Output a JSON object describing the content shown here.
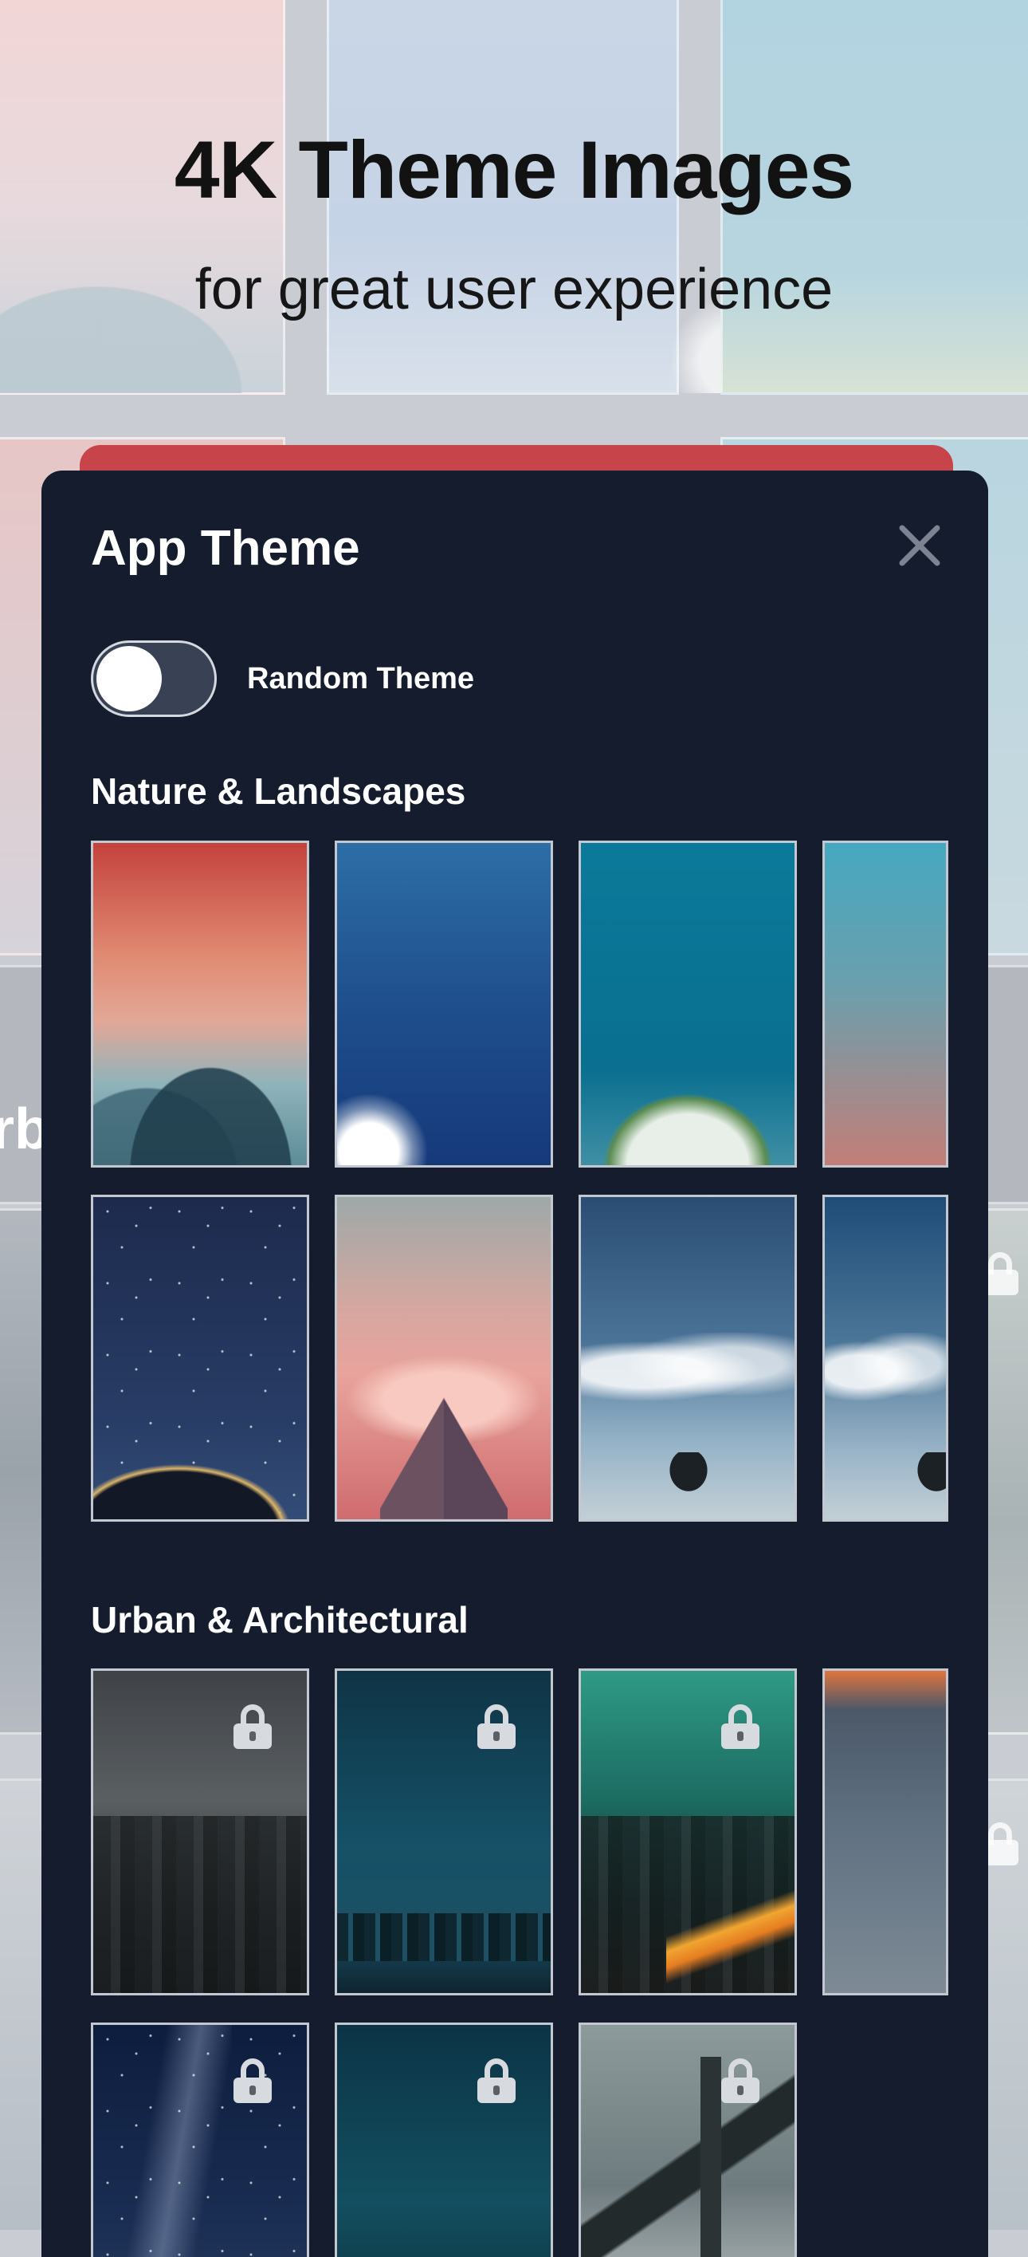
{
  "hero": {
    "title": "4K Theme Images",
    "subtitle": "for great user experience",
    "bg_partial_text": "rb"
  },
  "modal": {
    "title": "App Theme",
    "close_icon": "close-icon",
    "random_theme": {
      "label": "Random Theme",
      "enabled": false
    }
  },
  "sections": [
    {
      "title": "Nature & Landscapes",
      "themes": [
        {
          "id": "n1",
          "locked": false
        },
        {
          "id": "n2",
          "locked": false
        },
        {
          "id": "n3",
          "locked": false
        },
        {
          "id": "n4",
          "locked": false
        },
        {
          "id": "n5",
          "locked": false
        },
        {
          "id": "n6",
          "locked": false
        },
        {
          "id": "n7",
          "locked": false
        },
        {
          "id": "n8",
          "locked": false
        }
      ]
    },
    {
      "title": "Urban & Architectural",
      "themes": [
        {
          "id": "u1",
          "locked": true
        },
        {
          "id": "u2",
          "locked": true
        },
        {
          "id": "u3",
          "locked": true
        },
        {
          "id": "u4",
          "locked": false
        },
        {
          "id": "u5",
          "locked": true
        },
        {
          "id": "u6",
          "locked": true
        },
        {
          "id": "u7",
          "locked": true
        }
      ]
    }
  ],
  "colors": {
    "modal_bg": "#141c2e",
    "accent_bar": "#c7444a",
    "text": "#ffffff"
  }
}
